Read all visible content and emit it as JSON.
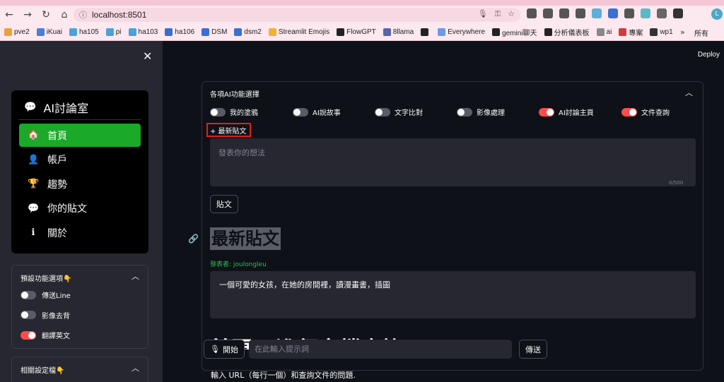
{
  "browser": {
    "url": "localhost:8501",
    "profile_initial": "L",
    "bookmarks": [
      {
        "label": "pve2",
        "color": "#e8a33b"
      },
      {
        "label": "iKuai",
        "color": "#4a7fd4"
      },
      {
        "label": "ha105",
        "color": "#4aa3d8"
      },
      {
        "label": "pi",
        "color": "#4aa3d8"
      },
      {
        "label": "ha103",
        "color": "#4aa3d8"
      },
      {
        "label": "ha106",
        "color": "#3a6fc8"
      },
      {
        "label": "DSM",
        "color": "#3b6fd6"
      },
      {
        "label": "dsm2",
        "color": "#3b6fd6"
      },
      {
        "label": "Streamlit Emojis",
        "color": "#f2b134"
      },
      {
        "label": "FlowGPT",
        "color": "#222222"
      },
      {
        "label": "8llama",
        "color": "#5566aa"
      },
      {
        "label": "",
        "color": "#222222"
      },
      {
        "label": "Everywhere",
        "color": "#6a9be8"
      },
      {
        "label": "gemini聊天",
        "color": "#222222"
      },
      {
        "label": "分析儀表板",
        "color": "#222222"
      },
      {
        "label": "ai",
        "color": "#888888"
      },
      {
        "label": "專案",
        "color": "#d43a3a"
      },
      {
        "label": "wp1",
        "color": "#333333"
      }
    ],
    "more_label": "»",
    "all_bookmarks_label": "所有"
  },
  "sidebar": {
    "menu_title": "AI討論室",
    "menu_items": [
      {
        "label": "首頁",
        "icon": "house-icon",
        "active": true
      },
      {
        "label": "帳戶",
        "icon": "person-circle-icon",
        "active": false
      },
      {
        "label": "趨勢",
        "icon": "trophy-icon",
        "active": false
      },
      {
        "label": "你的貼文",
        "icon": "chat-bubble-icon",
        "active": false
      },
      {
        "label": "關於",
        "icon": "info-circle-icon",
        "active": false
      }
    ],
    "preset_title": "預設功能選項👇",
    "preset_toggles": [
      {
        "label": "傳送Line",
        "on": false
      },
      {
        "label": "影像去背",
        "on": false
      },
      {
        "label": "翻譯英文",
        "on": true
      }
    ],
    "settings_title": "相關設定檔👇"
  },
  "main": {
    "deploy_label": "Deploy",
    "panel_title": "各項AI功能選擇",
    "features": [
      {
        "label": "我的塗鴉",
        "on": false
      },
      {
        "label": "AI說故事",
        "on": false
      },
      {
        "label": "文字比對",
        "on": false
      },
      {
        "label": "影像處理",
        "on": false
      },
      {
        "label": "AI討論主頁",
        "on": true
      },
      {
        "label": "文件查詢",
        "on": true
      }
    ],
    "new_post_label": "+ 最新貼文",
    "post_placeholder": "發表你的想法",
    "post_counter": "0/500",
    "post_button": "貼文",
    "latest_heading": "最新貼文",
    "author_line": "發表者: joulongleu",
    "post_content": "一個可愛的女孩，在她的房間裡，讀漫畫書，插圖",
    "ghost_heading": "首頁 - 進行文檔查詢",
    "start_button": "開始",
    "chat_placeholder": "在此輸入提示詞",
    "send_button": "傳送",
    "hint_text": "輸入 URL（每行一個）和查詢文件的問題."
  }
}
